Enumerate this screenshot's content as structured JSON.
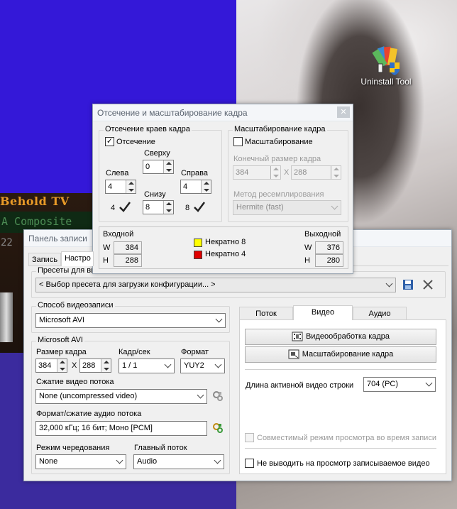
{
  "desktop": {
    "icon_label": "Uninstall Tool"
  },
  "behold": {
    "title": "Behold TV",
    "screen_text": "A Composite",
    "counter": "22"
  },
  "crop_dialog": {
    "title": "Отсечение и масштабирование кадра",
    "crop_group": "Отсечение краев кадра",
    "crop_check_label": "Отсечение",
    "crop_checked": true,
    "top_label": "Сверху",
    "top_value": "0",
    "left_label": "Слева",
    "left_value": "4",
    "right_label": "Справа",
    "right_value": "4",
    "bottom_label": "Снизу",
    "bottom_value": "8",
    "left_mark": "4",
    "right_mark": "8",
    "scale_group": "Масштабирование кадра",
    "scale_check_label": "Масштабирование",
    "scale_checked": false,
    "final_size_label": "Конечный размер кадра",
    "final_w": "384",
    "final_x": "X",
    "final_h": "288",
    "resample_label": "Метод ресемплирования",
    "resample_value": "Hermite (fast)",
    "input_label": "Входной",
    "input_w_label": "W",
    "input_w": "384",
    "input_h_label": "H",
    "input_h": "288",
    "legend": [
      {
        "label": "Некратно 8",
        "color": "#ffff00"
      },
      {
        "label": "Некратно 4",
        "color": "#e00000"
      }
    ],
    "output_label": "Выходной",
    "output_w_label": "W",
    "output_w": "376",
    "output_h_label": "H",
    "output_h": "280"
  },
  "record_panel": {
    "title": "Панель записи",
    "tabs": [
      "Запись",
      "Настро"
    ],
    "presets_label": "Пресеты для ви",
    "preset_value": "< Выбор пресета для загрузки конфигурации... >",
    "capture_method_label": "Способ видеозаписи",
    "capture_method_value": "Microsoft AVI",
    "avi_group": "Microsoft AVI",
    "frame_size_label": "Размер кадра",
    "frame_w": "384",
    "frame_x": "X",
    "frame_h": "288",
    "fps_label": "Кадр/сек",
    "fps_value": "1 / 1",
    "format_label": "Формат",
    "format_value": "YUY2",
    "video_compression_label": "Сжатие видео потока",
    "video_compression_value": "None (uncompressed video)",
    "audio_format_label": "Формат/сжатие аудио потока",
    "audio_format_value": "32,000 кГц; 16 бит; Моно [PCM]",
    "interleave_label": "Режим чередования",
    "interleave_value": "None",
    "main_stream_label": "Главный поток",
    "main_stream_value": "Audio",
    "right_tabs": [
      "Поток",
      "Видео",
      "Аудио"
    ],
    "active_right_tab": "Видео",
    "video_processing_button": "Видеообработка кадра",
    "frame_scaling_button": "Масштабирование кадра",
    "active_line_label": "Длина активной видео строки",
    "active_line_value": "704 (PC)",
    "compat_mode_label": "Совместимый режим просмотра во время записи",
    "no_preview_label": "Не выводить на просмотр записываемое видео"
  }
}
